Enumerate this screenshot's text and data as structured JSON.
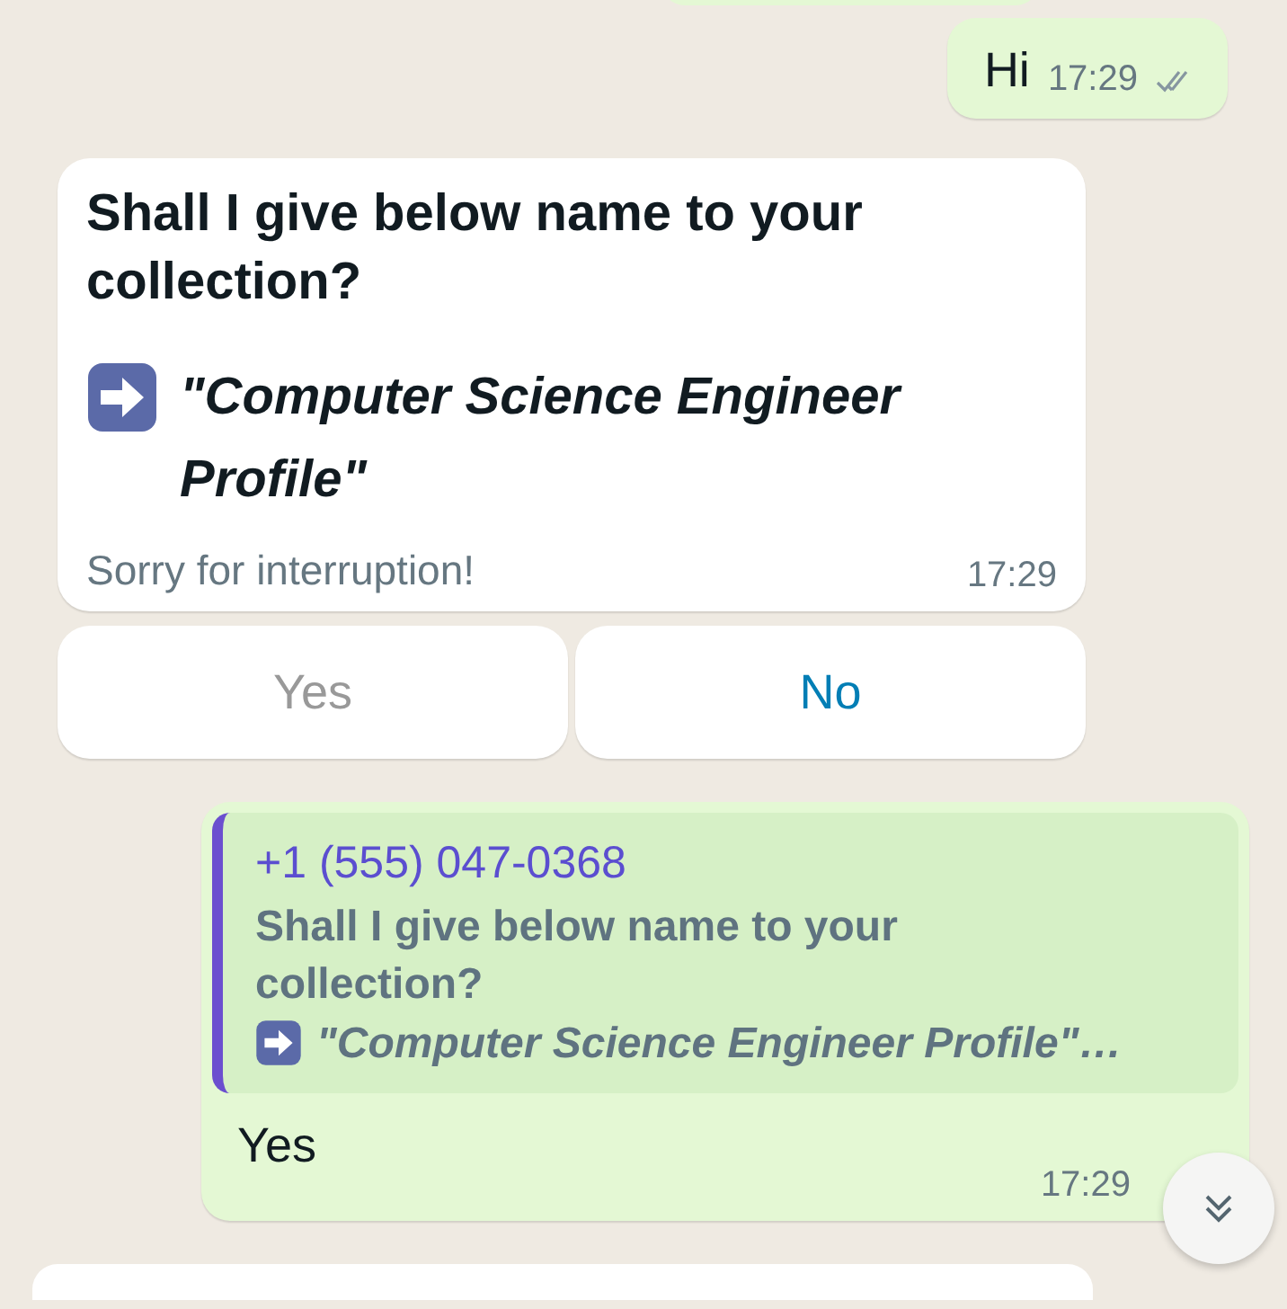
{
  "messages": [
    {
      "kind": "outgoing-edge"
    },
    {
      "kind": "outgoing",
      "text": "Hi",
      "time": "17:29",
      "read": false
    },
    {
      "kind": "incoming",
      "title": "Shall I give below name to your collection?",
      "quote": "\"Computer Science Engineer Profile\"",
      "footer": "Sorry for interruption!",
      "time": "17:29",
      "buttons": [
        {
          "label": "Yes",
          "disabled": true
        },
        {
          "label": "No",
          "disabled": false
        }
      ]
    },
    {
      "kind": "reply",
      "quoted_sender": "+1 (555) 047-0368",
      "quoted_text": "Shall I give below name to your collection?",
      "quoted_name": "\"Computer Science Engineer Profile\"…",
      "text": "Yes",
      "time": "17:29"
    },
    {
      "kind": "incoming-edge"
    }
  ]
}
